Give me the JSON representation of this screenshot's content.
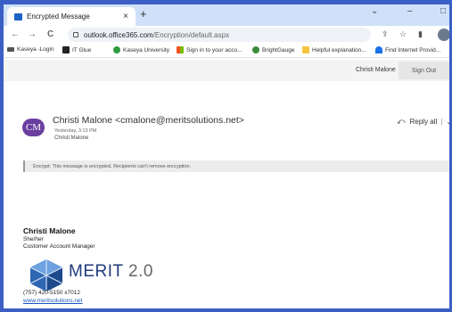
{
  "browser": {
    "tab_title": "Encrypted Message",
    "tab_close": "×",
    "new_tab": "+",
    "window_controls": [
      "⌄",
      "–",
      "□"
    ],
    "nav": {
      "back": "←",
      "forward": "→",
      "reload": "C"
    },
    "url_host": "outlook.office365.com",
    "url_path": "/Encryption/default.aspx",
    "bookmarks": [
      {
        "label": "Kaseya -Login",
        "icon": "kaseya-icon",
        "color": "#555555"
      },
      {
        "label": "IT Glue",
        "icon": "itglue-icon",
        "color": "#222222"
      },
      {
        "label": "Kaseya University",
        "icon": "kaseya-university-icon",
        "color": "#2e9b3e"
      },
      {
        "label": "Sign in to your acco...",
        "icon": "microsoft-icon",
        "color": "#f2a900"
      },
      {
        "label": "BrightGauge",
        "icon": "brightgauge-icon",
        "color": "#3c8c3c"
      },
      {
        "label": "Helpful explanation...",
        "icon": "folder-icon",
        "color": "#f5c542"
      },
      {
        "label": "Find Internet Provid...",
        "icon": "wifi-icon",
        "color": "#1a73e8"
      }
    ]
  },
  "owa": {
    "user": "Christi Malone",
    "sign_out": "Sign Out"
  },
  "message": {
    "initials": "CM",
    "from": "Christi Malone <cmalone@meritsolutions.net>",
    "date": "Yesterday, 3:13 PM",
    "to": "Christi Malone",
    "reply_all": "Reply all",
    "reply_sep": "|",
    "reply_chevron": "⌄",
    "encrypt_notice": "Encrypt: This message is encrypted. Recipients can't remove encryption."
  },
  "signature": {
    "name": "Christi Malone",
    "pronouns": "She/her",
    "role": "Customer Account Manager",
    "logo_word": "MERIT",
    "logo_version": " 2.0",
    "phone": "(757) 420-5150 x7012",
    "website": "www.meritsolutions.net"
  },
  "colors": {
    "accent": "#1e62c8",
    "avatar": "#6a3fa0",
    "logo_blue": "#1f3a7a"
  }
}
